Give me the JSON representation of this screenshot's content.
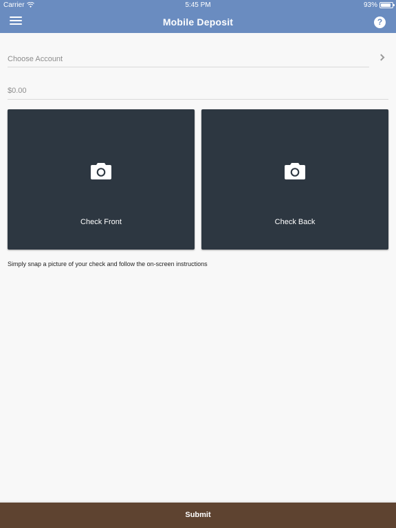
{
  "status_bar": {
    "carrier": "Carrier",
    "time": "5:45 PM",
    "battery": "93%"
  },
  "header": {
    "title": "Mobile Deposit",
    "help_label": "?"
  },
  "account": {
    "placeholder": "Choose Account"
  },
  "amount": {
    "placeholder": "$0.00"
  },
  "capture": {
    "front_label": "Check Front",
    "back_label": "Check Back"
  },
  "instructions": "Simply snap a picture of your check and follow the on-screen instructions",
  "footer": {
    "submit_label": "Submit"
  },
  "colors": {
    "header_bg": "#6a8cc0",
    "card_bg": "#2d3741",
    "submit_bg": "#5e4330"
  }
}
